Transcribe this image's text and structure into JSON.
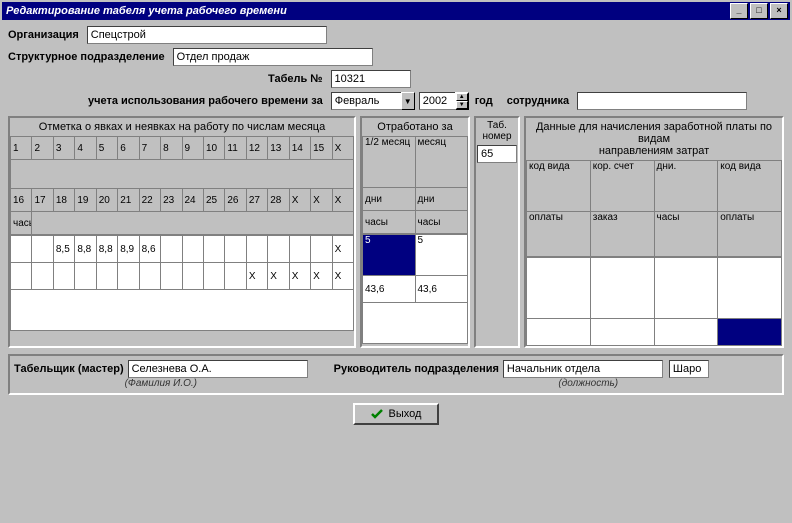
{
  "window": {
    "title": "Редактирование табеля учета рабочего времени",
    "min": "_",
    "max": "□",
    "close": "×"
  },
  "form": {
    "org_label": "Организация",
    "org_value": "Спецстрой",
    "dept_label": "Структурное подразделение",
    "dept_value": "Отдел продаж",
    "tabel_label": "Табель №",
    "tabel_value": "10321",
    "period_label": "учета использования рабочего времени за",
    "month_value": "Февраль",
    "year_value": "2002",
    "year_label": "год",
    "emp_label": "сотрудника",
    "emp_value": ""
  },
  "panels": {
    "attendance_hdr": "Отметка о явках и неявках на работу по числам месяца",
    "worked_hdr": "Отработано за",
    "tabno_hdr": "Таб. номер",
    "payroll_hdr": "Данные для начисления заработной платы по видам\nнаправлениям затрат"
  },
  "attendance": {
    "row1": [
      "1",
      "2",
      "3",
      "4",
      "5",
      "6",
      "7",
      "8",
      "9",
      "10",
      "11",
      "12",
      "13",
      "14",
      "15",
      "X"
    ],
    "row2": [
      "16",
      "17",
      "18",
      "19",
      "20",
      "21",
      "22",
      "23",
      "24",
      "25",
      "26",
      "27",
      "28",
      "X",
      "X",
      "X"
    ],
    "data1": [
      "",
      "",
      "8,5",
      "8,8",
      "8,8",
      "8,9",
      "8,6",
      "",
      "",
      "",
      "",
      "",
      "",
      "",
      "",
      "X"
    ],
    "data2": [
      "",
      "",
      "",
      "",
      "",
      "",
      "",
      "",
      "",
      "",
      "",
      "X",
      "X",
      "X",
      "X",
      "X"
    ]
  },
  "worked": {
    "h1": "1/2 месяц",
    "h2": "месяц",
    "h3": "дни",
    "h4": "дни",
    "h5": "часы",
    "h6": "часы",
    "d1": "5",
    "d2": "5",
    "d3": "43,6",
    "d4": "43,6"
  },
  "tabno": {
    "value": "65"
  },
  "payroll": {
    "c1": "код вида",
    "c2": "кор. счет",
    "c3": "дни.",
    "c4": "код вида",
    "r1": "оплаты",
    "r2": "заказ",
    "r3": "часы",
    "r4": "оплаты"
  },
  "footer": {
    "tab_master_label": "Табельщик (мастер)",
    "tab_master_value": "Селезнева О.А.",
    "tab_master_hint": "(Фамилия И.О.)",
    "head_label": "Руководитель подразделения",
    "head_value": "Начальник отдела",
    "head_hint": "(должность)",
    "extra_value": "Шаро"
  },
  "button": {
    "exit": "Выход"
  }
}
